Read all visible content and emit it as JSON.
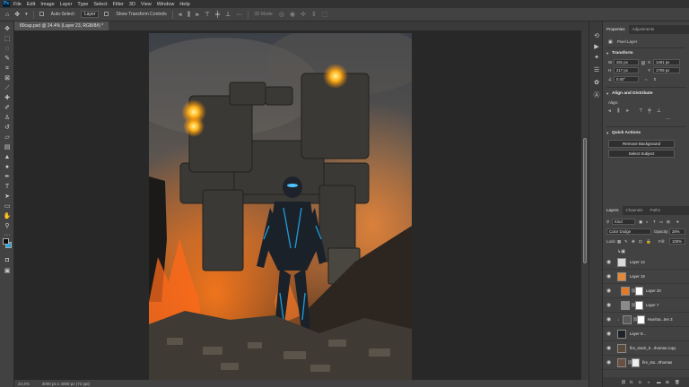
{
  "menubar": {
    "app_icon": "Ps",
    "items": [
      "File",
      "Edit",
      "Image",
      "Layer",
      "Type",
      "Select",
      "Filter",
      "3D",
      "View",
      "Window",
      "Help"
    ]
  },
  "options": {
    "tool_icon": "move-tool-icon",
    "auto_select_label": "Auto-Select:",
    "auto_select_value": "Layer",
    "show_transform_label": "Show Transform Controls",
    "mode_label": "3D Mode:"
  },
  "document": {
    "tab_title": "80cap.psd @ 24.4% (Layer 23, RGB/8#) *"
  },
  "statusbar": {
    "zoom": "24.4%",
    "doc_size": "3000 px x 4000 px (72 ppi)"
  },
  "colors": {
    "foreground": "#0b0b0b",
    "background": "#1ea3e0",
    "accent": "#31a8ff"
  },
  "properties": {
    "tabs": [
      "Properties",
      "Adjustments"
    ],
    "layer_type": "Pixel Layer",
    "transform_heading": "Transform",
    "w_label": "W",
    "w_value": "281 px",
    "h_label": "H",
    "h_value": "217 px",
    "x_label": "X",
    "x_value": "1491 px",
    "y_label": "Y",
    "y_value": "1709 px",
    "angle_value": "0.00°",
    "align_heading": "Align and Distribute",
    "align_label": "Align:",
    "quick_actions_heading": "Quick Actions",
    "remove_bg_button": "Remove Background",
    "select_subject_button": "Select Subject"
  },
  "layers": {
    "tabs": [
      "Layers",
      "Channels",
      "Paths"
    ],
    "filter_label": "Kind",
    "blend_mode": "Color Dodge",
    "opacity_label": "Opacity:",
    "opacity_value": "28%",
    "lock_label": "Lock:",
    "fill_label": "Fill:",
    "fill_value": "100%",
    "items": [
      {
        "name": "Layer 14",
        "has_mask": false,
        "selected": false
      },
      {
        "name": "Layer 19",
        "has_mask": false,
        "selected": false
      },
      {
        "name": "Layer 20",
        "has_mask": true,
        "selected": false
      },
      {
        "name": "Layer 7",
        "has_mask": true,
        "selected": false
      },
      {
        "name": "Hue/Sa...ten 3",
        "has_mask": true,
        "selected": false
      },
      {
        "name": "Layer 8...",
        "has_mask": false,
        "selected": false
      },
      {
        "name": "fire_stock_0...rhomas copy",
        "has_mask": false,
        "selected": false
      },
      {
        "name": "fire_sto...rthomas",
        "has_mask": true,
        "selected": false
      }
    ]
  }
}
